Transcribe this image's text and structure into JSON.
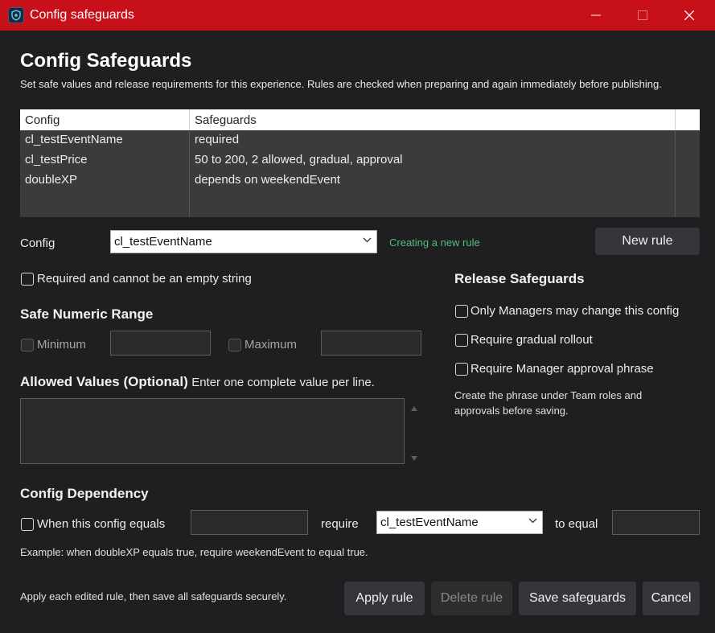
{
  "window": {
    "title": "Config safeguards",
    "app_icon": "shield-icon",
    "minimize_icon": "minimize-icon",
    "maximize_icon": "maximize-icon",
    "close_icon": "close-icon",
    "title_bar_color": "#c8101a"
  },
  "header": {
    "title": "Config Safeguards",
    "subtitle": "Set safe values and release requirements for this experience. Rules are checked when preparing and again immediately before publishing."
  },
  "table": {
    "columns": [
      "Config",
      "Safeguards"
    ],
    "rows": [
      {
        "config": "cl_testEventName",
        "safeguards": "required"
      },
      {
        "config": "cl_testPrice",
        "safeguards": "50 to 200, 2 allowed, gradual, approval"
      },
      {
        "config": "doubleXP",
        "safeguards": "depends on weekendEvent"
      }
    ]
  },
  "config_selector": {
    "label": "Config",
    "selected": "cl_testEventName",
    "status": "Creating a new rule",
    "status_color": "#4fc07a",
    "new_rule_label": "New rule"
  },
  "required": {
    "label": "Required and cannot be an empty string",
    "checked": false
  },
  "numeric_range": {
    "title": "Safe Numeric Range",
    "minimum_label": "Minimum",
    "maximum_label": "Maximum",
    "minimum_value": "",
    "maximum_value": ""
  },
  "allowed_values": {
    "title": "Allowed Values (Optional)",
    "hint": "Enter one complete value per line.",
    "value": ""
  },
  "release": {
    "title": "Release Safeguards",
    "options": [
      {
        "label": "Only Managers may change this config",
        "checked": false
      },
      {
        "label": "Require gradual rollout",
        "checked": false
      },
      {
        "label": "Require Manager approval phrase",
        "checked": false
      }
    ],
    "note_line1": "Create the phrase under Team roles and",
    "note_line2": "approvals before saving."
  },
  "dependency": {
    "title": "Config Dependency",
    "when_label": "When this config equals",
    "when_value": "",
    "require_label": "require",
    "require_selected": "cl_testEventName",
    "to_equal_label": "to equal",
    "to_equal_value": "",
    "example": "Example: when doubleXP equals true, require weekendEvent to equal true."
  },
  "footer": {
    "hint": "Apply each edited rule, then save all safeguards securely.",
    "apply_label": "Apply rule",
    "delete_label": "Delete rule",
    "save_label": "Save safeguards",
    "cancel_label": "Cancel"
  }
}
